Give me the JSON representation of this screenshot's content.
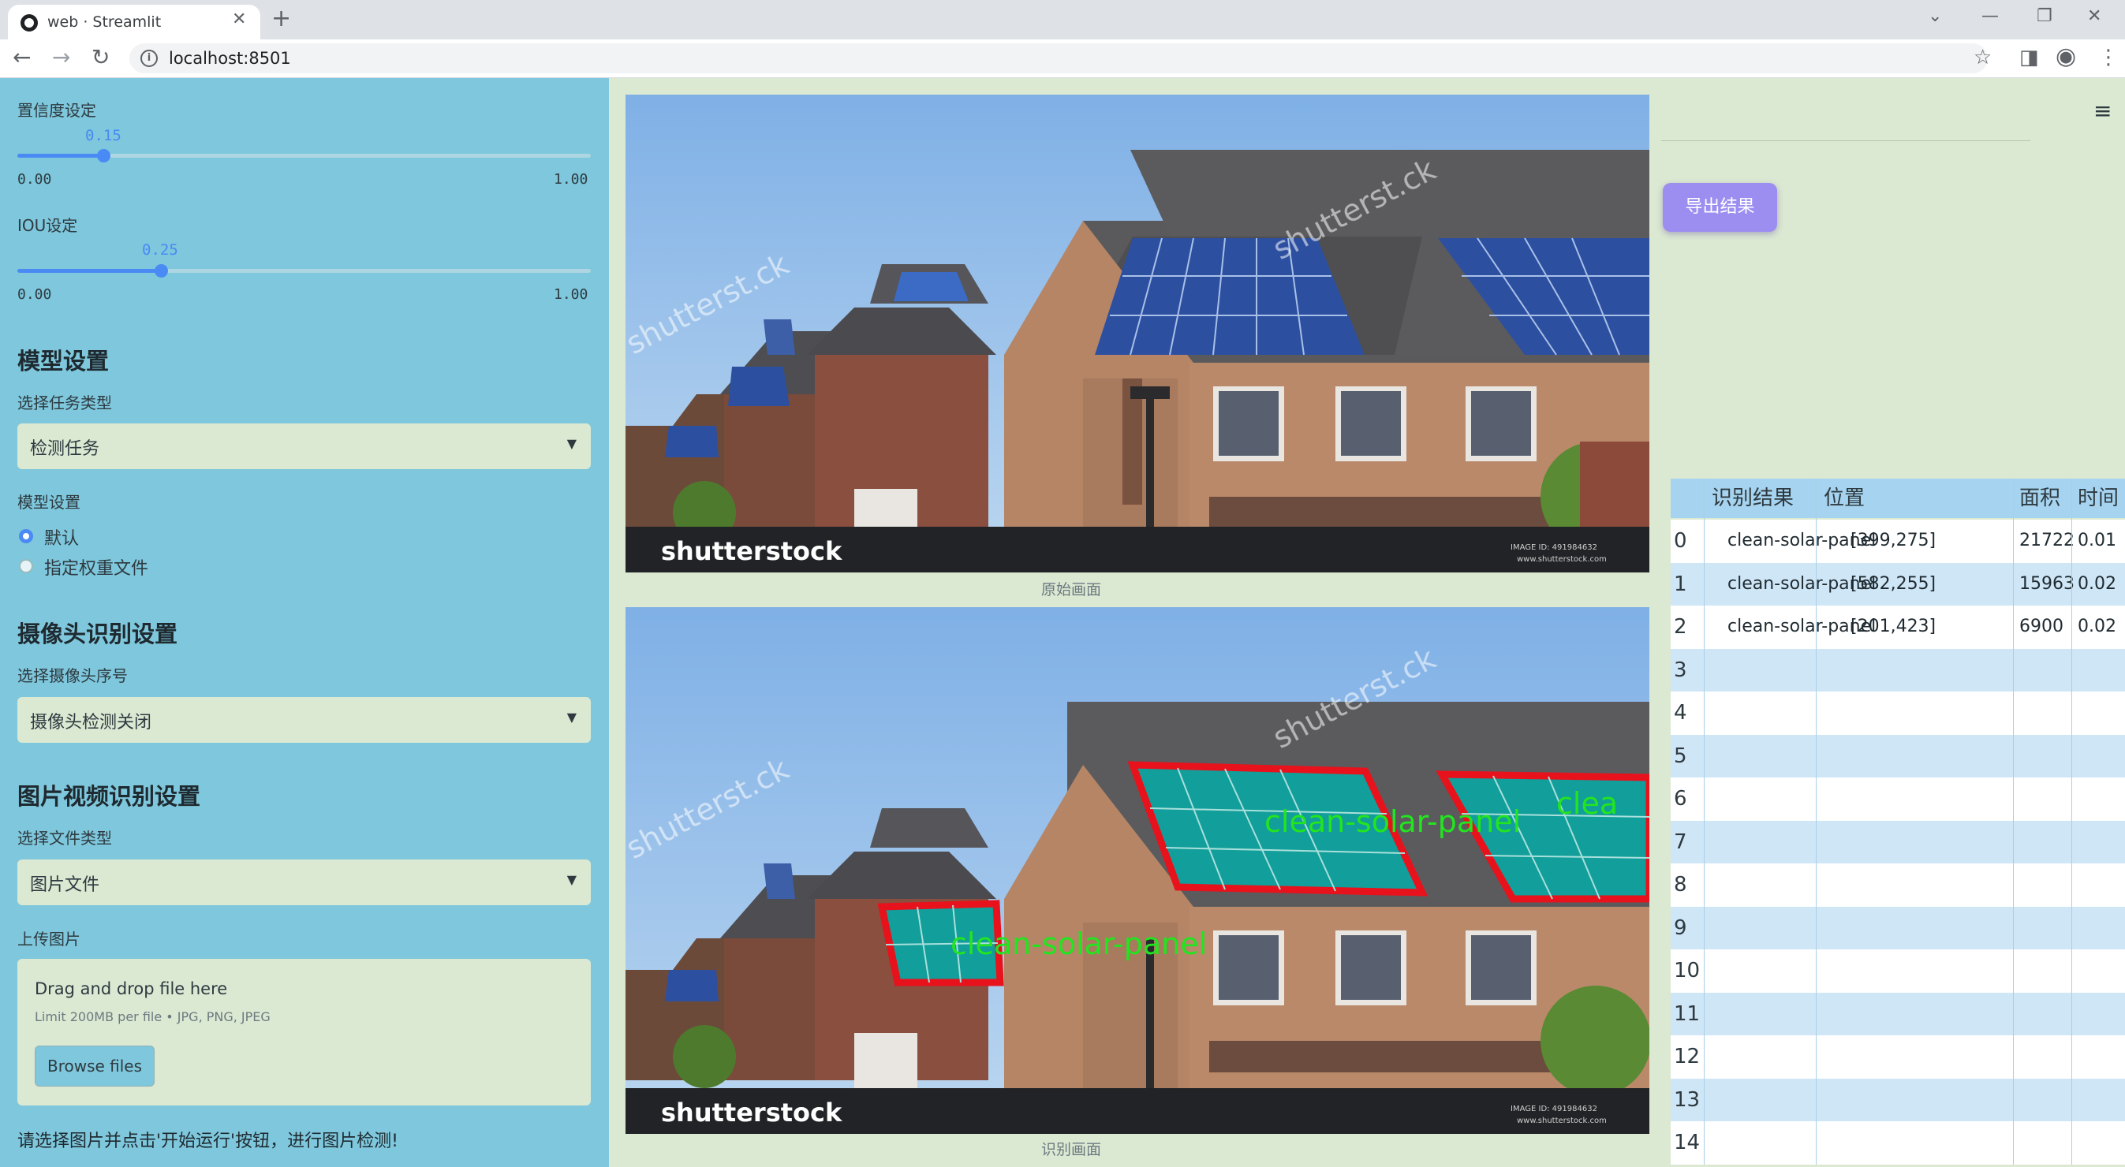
{
  "browser": {
    "tab_title": "web · Streamlit",
    "url": "localhost:8501",
    "new_tab": "+",
    "tab_close": "✕"
  },
  "sidebar": {
    "conf_label": "置信度设定",
    "conf_value": "0.15",
    "conf_level": 0.15,
    "conf_min": "0.00",
    "conf_max": "1.00",
    "iou_label": "IOU设定",
    "iou_value": "0.25",
    "iou_level": 0.25,
    "iou_min": "0.00",
    "iou_max": "1.00",
    "model_header": "模型设置",
    "task_label": "选择任务类型",
    "task_value": "检测任务",
    "model_label": "模型设置",
    "radio_default": "默认",
    "radio_custom": "指定权重文件",
    "camera_header": "摄像头识别设置",
    "camera_label": "选择摄像头序号",
    "camera_value": "摄像头检测关闭",
    "media_header": "图片视频识别设置",
    "filetype_label": "选择文件类型",
    "filetype_value": "图片文件",
    "upload_label": "上传图片",
    "upload_title": "Drag and drop file here",
    "upload_limit": "Limit 200MB per file • JPG, PNG, JPEG",
    "browse_label": "Browse files",
    "hint": "请选择图片并点击'开始运行'按钮，进行图片检测!"
  },
  "main": {
    "original_caption": "原始画面",
    "result_caption": "识别画面",
    "watermark_brand": "shutterstock",
    "watermark_small": "IMAGE ID: 491984632",
    "watermark_site": "www.shutterstock.com",
    "watermark_diag": "shutterst.ck",
    "detection_label": "clean-solar-panel",
    "detection_label_partial": "clea"
  },
  "results": {
    "export_label": "导出结果",
    "columns": [
      "识别结果",
      "位置",
      "面积",
      "时间"
    ],
    "rows": [
      {
        "index": "0",
        "label": "clean-solar-panel",
        "pos": "[399,275]",
        "area": "21722",
        "time": "0.01"
      },
      {
        "index": "1",
        "label": "clean-solar-panel",
        "pos": "[582,255]",
        "area": "15963",
        "time": "0.02"
      },
      {
        "index": "2",
        "label": "clean-solar-panel",
        "pos": "[201,423]",
        "area": "6900",
        "time": "0.02"
      },
      {
        "index": "3"
      },
      {
        "index": "4"
      },
      {
        "index": "5"
      },
      {
        "index": "6"
      },
      {
        "index": "7"
      },
      {
        "index": "8"
      },
      {
        "index": "9"
      },
      {
        "index": "10"
      },
      {
        "index": "11"
      },
      {
        "index": "12"
      },
      {
        "index": "13"
      },
      {
        "index": "14"
      }
    ]
  },
  "colors": {
    "sidebar_bg": "#7ec7dc",
    "main_bg": "#dbe8d2",
    "accent": "#4a8af4",
    "export_button": "#9b8ef0",
    "box_red": "#e8121c",
    "label_green": "#22e51f",
    "row_blue": "#cfe6f7"
  }
}
